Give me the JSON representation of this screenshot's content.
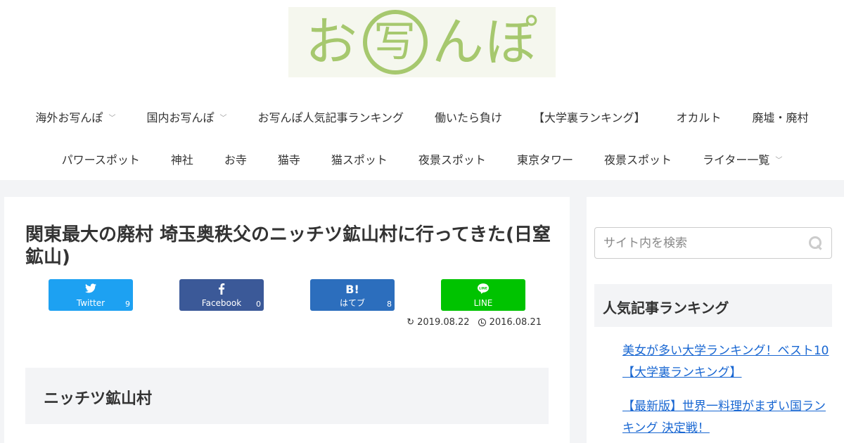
{
  "site": {
    "logo_parts": [
      "お",
      "写",
      "んぽ"
    ]
  },
  "nav": {
    "row1": [
      {
        "label": "海外お写んぽ",
        "has_submenu": true
      },
      {
        "label": "国内お写んぽ",
        "has_submenu": true
      },
      {
        "label": "お写んぽ人気記事ランキング",
        "has_submenu": false
      },
      {
        "label": "働いたら負け",
        "has_submenu": false
      },
      {
        "label": "【大学裏ランキング】",
        "has_submenu": false
      },
      {
        "label": "オカルト",
        "has_submenu": false
      },
      {
        "label": "廃墟・廃村",
        "has_submenu": false
      }
    ],
    "row2": [
      {
        "label": "パワースポット",
        "has_submenu": false
      },
      {
        "label": "神社",
        "has_submenu": false
      },
      {
        "label": "お寺",
        "has_submenu": false
      },
      {
        "label": "猫寺",
        "has_submenu": false
      },
      {
        "label": "猫スポット",
        "has_submenu": false
      },
      {
        "label": "夜景スポット",
        "has_submenu": false
      },
      {
        "label": "東京タワー",
        "has_submenu": false
      },
      {
        "label": "夜景スポット",
        "has_submenu": false
      },
      {
        "label": "ライター一覧",
        "has_submenu": true
      }
    ]
  },
  "article": {
    "title": "関東最大の廃村 埼玉奥秩父のニッチツ鉱山村に行ってきた(日窒鉱山)",
    "updated_date": "2019.08.22",
    "published_date": "2016.08.21",
    "first_heading": "ニッチツ鉱山村"
  },
  "share": {
    "twitter": {
      "label": "Twitter",
      "count": "9"
    },
    "facebook": {
      "label": "Facebook",
      "count": "0"
    },
    "hatebu": {
      "icon_text": "B!",
      "label": "はてブ",
      "count": "8"
    },
    "line": {
      "label": "LINE",
      "count": ""
    }
  },
  "sidebar": {
    "search_placeholder": "サイト内を検索",
    "widget_title": "人気記事ランキング",
    "ranking": [
      "美女が多い大学ランキング！ベスト10【大学裏ランキング】",
      "【最新版】世界一料理がまずい国ランキング 決定戦！"
    ]
  },
  "colors": {
    "logo_green": "#a6c86e",
    "twitter": "#1da1f2",
    "facebook": "#3b5998",
    "hatebu": "#2c6ebd",
    "line": "#00c300",
    "link": "#1967d2"
  }
}
